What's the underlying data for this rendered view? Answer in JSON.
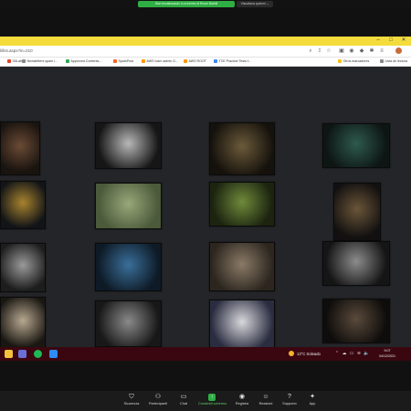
{
  "share_banner": {
    "status_text": "Stai visualizzando lo schermo di Rover Baielli",
    "options_label": "Visualizza opzioni ⌄"
  },
  "browser": {
    "address": "li/list.aspx?in=210"
  },
  "bookmarks": [
    {
      "label": "GitLab",
      "color": "#e24329"
    },
    {
      "label": "Newsletters spam l...",
      "color": "#888888"
    },
    {
      "label": "Approved Contents...",
      "color": "#34a853"
    },
    {
      "label": "SparkPost",
      "color": "#fa6423"
    },
    {
      "label": "AWS Iosm admin G...",
      "color": "#ff9900"
    },
    {
      "label": "AWS ROOT",
      "color": "#ff9900"
    },
    {
      "label": "TCE Practice Tests f...",
      "color": "#4285f4"
    }
  ],
  "bookmarks_right": [
    {
      "label": "Otros marcadores",
      "color": "#f4c20d"
    },
    {
      "label": "Lista de lectura",
      "color": "#888888"
    }
  ],
  "taskbar": {
    "weather": "13°C  Soleado",
    "time": "9:07",
    "date": "04/12/2021"
  },
  "zoom_controls": [
    {
      "label": "Sicurezza",
      "icon": "shield-icon",
      "glyph": "⛉"
    },
    {
      "label": "Partecipanti",
      "icon": "participants-icon",
      "glyph": "👥"
    },
    {
      "label": "Chat",
      "icon": "chat-icon",
      "glyph": "💬"
    },
    {
      "label": "Condividi schermo",
      "icon": "share-screen-icon",
      "glyph": "↑"
    },
    {
      "label": "Registra",
      "icon": "record-icon",
      "glyph": "◉"
    },
    {
      "label": "Reazioni",
      "icon": "reactions-icon",
      "glyph": "☺"
    },
    {
      "label": "Supporto",
      "icon": "support-icon",
      "glyph": "?"
    },
    {
      "label": "App",
      "icon": "apps-icon",
      "glyph": "✦"
    }
  ],
  "photos": [
    {
      "name": "photo-woman-reading",
      "colors": [
        "#6a4a34",
        "#1a1410"
      ]
    },
    {
      "name": "photo-bird-wings",
      "colors": [
        "#b8b8b8",
        "#161616"
      ]
    },
    {
      "name": "photo-man-lantern",
      "colors": [
        "#6b5a3a",
        "#15110c"
      ]
    },
    {
      "name": "photo-woman-green-dress",
      "colors": [
        "#2e5a4e",
        "#0e1614"
      ]
    },
    {
      "name": "photo-golden-ornament",
      "colors": [
        "#a8832e",
        "#121417"
      ]
    },
    {
      "name": "photo-woman-grass",
      "colors": [
        "#9aa77a",
        "#4a5a3a"
      ]
    },
    {
      "name": "photo-duck-water",
      "colors": [
        "#6f8a3a",
        "#1c2410"
      ]
    },
    {
      "name": "photo-lamp-window",
      "colors": [
        "#6a5538",
        "#121010"
      ]
    },
    {
      "name": "photo-dancers-bw",
      "colors": [
        "#9a9a9a",
        "#1d1d1d"
      ]
    },
    {
      "name": "photo-girl-water-blue",
      "colors": [
        "#3a6f9a",
        "#0e1a26"
      ]
    },
    {
      "name": "photo-village-walk",
      "colors": [
        "#8a7a66",
        "#2c261f"
      ]
    },
    {
      "name": "photo-child-porthole",
      "colors": [
        "#8c8c8c",
        "#151515"
      ]
    },
    {
      "name": "photo-woman-candle",
      "colors": [
        "#b8a890",
        "#1a1712"
      ]
    },
    {
      "name": "photo-elephants-bw",
      "colors": [
        "#8a8a8a",
        "#181818"
      ]
    },
    {
      "name": "photo-taekwondo",
      "colors": [
        "#d8d8dc",
        "#2a2d40"
      ]
    },
    {
      "name": "photo-couple-dark",
      "colors": [
        "#5a4a3c",
        "#0f0d0b"
      ]
    }
  ]
}
